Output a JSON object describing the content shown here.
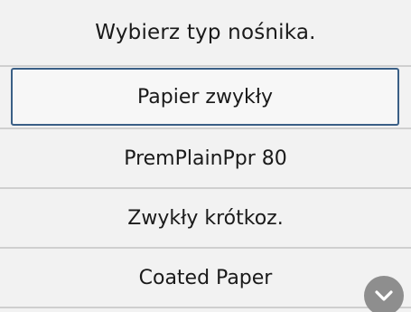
{
  "header": {
    "title": "Wybierz typ nośnika."
  },
  "media_list": {
    "items": [
      {
        "label": "Papier zwykły",
        "selected": true
      },
      {
        "label": "PremPlainPpr 80",
        "selected": false
      },
      {
        "label": "Zwykły krótkoz.",
        "selected": false
      },
      {
        "label": "Coated Paper",
        "selected": false
      }
    ]
  },
  "scroll": {
    "icon": "chevron-down-icon"
  },
  "colors": {
    "selection_border": "#3a5f86",
    "divider": "#cfcfcf",
    "scroll_button": "#8e8e8e"
  }
}
